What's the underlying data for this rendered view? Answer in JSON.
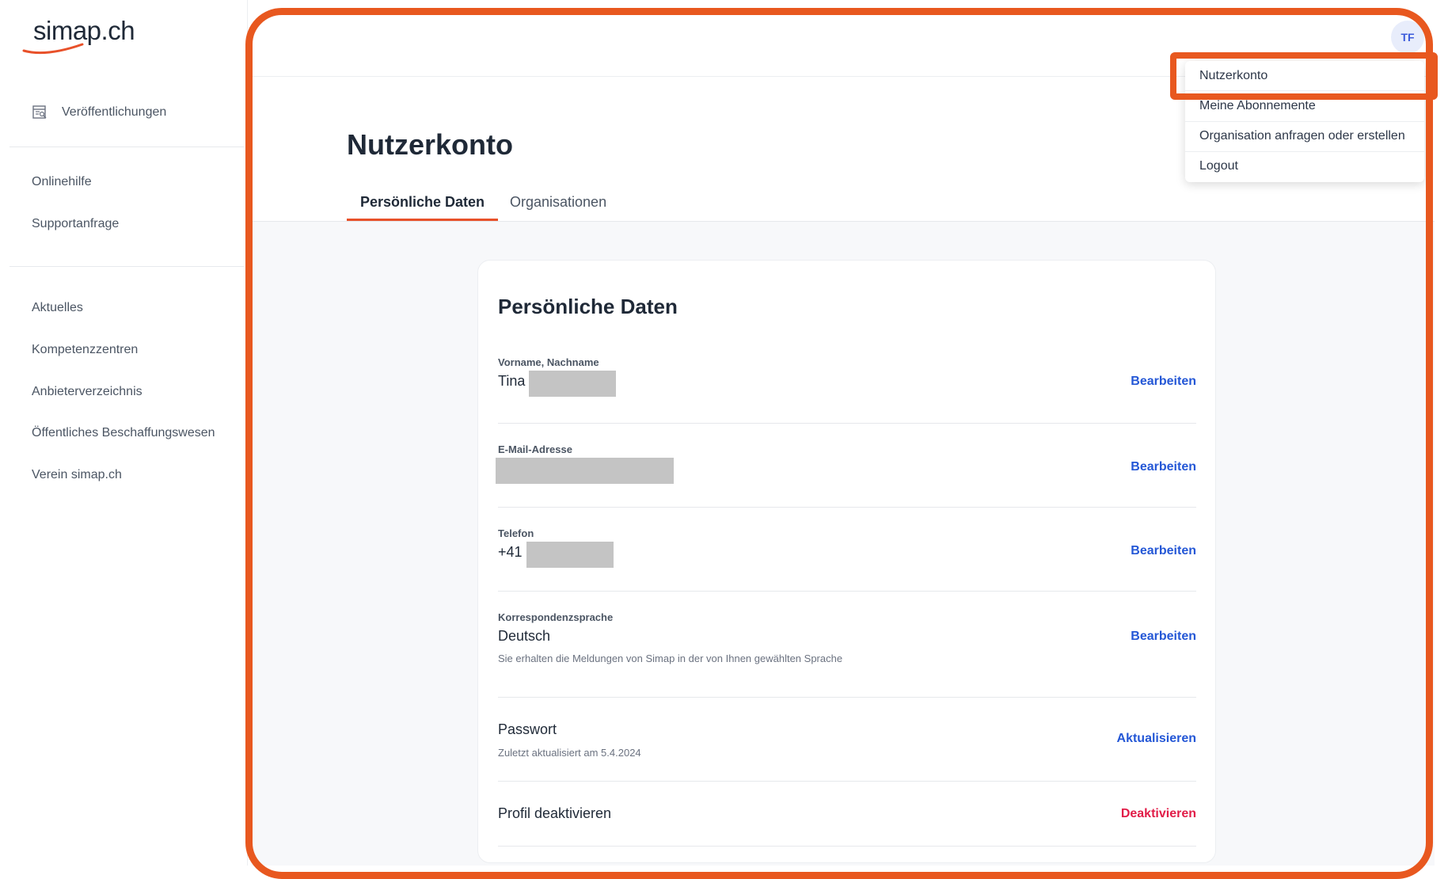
{
  "sidebar": {
    "logo": "simap.ch",
    "publications": {
      "label": "Veröffentlichungen",
      "icon": "publications-icon"
    },
    "help_links": [
      "Onlinehilfe",
      "Supportanfrage"
    ],
    "info_links": [
      "Aktuelles",
      "Kompetenzzentren",
      "Anbieterverzeichnis",
      "Öffentliches Beschaffungswesen",
      "Verein simap.ch"
    ]
  },
  "header": {
    "avatar_initials": "TF",
    "menu": [
      "Nutzerkonto",
      "Meine Abonnemente",
      "Organisation anfragen oder erstellen",
      "Logout"
    ]
  },
  "page": {
    "title": "Nutzerkonto",
    "tabs": [
      "Persönliche Daten",
      "Organisationen"
    ],
    "active_tab": "Persönliche Daten"
  },
  "card": {
    "title": "Persönliche Daten",
    "name": {
      "label": "Vorname, Nachname",
      "value": "Tina",
      "action": "Bearbeiten"
    },
    "email": {
      "label": "E-Mail-Adresse",
      "value": "",
      "action": "Bearbeiten"
    },
    "phone": {
      "label": "Telefon",
      "value": "+41",
      "action": "Bearbeiten"
    },
    "language": {
      "label": "Korrespondenzsprache",
      "value": "Deutsch",
      "note": "Sie erhalten die Meldungen von Simap in der von Ihnen gewählten Sprache",
      "action": "Bearbeiten"
    },
    "password": {
      "title": "Passwort",
      "note": "Zuletzt aktualisiert am 5.4.2024",
      "action": "Aktualisieren"
    },
    "deactivate": {
      "title": "Profil deaktivieren",
      "action": "Deaktivieren"
    }
  },
  "colors": {
    "accent": "#e8581f",
    "link": "#2457d6",
    "danger": "#e11d48",
    "avatar_bg": "#e8edfb",
    "redaction": "#c4c4c4"
  }
}
